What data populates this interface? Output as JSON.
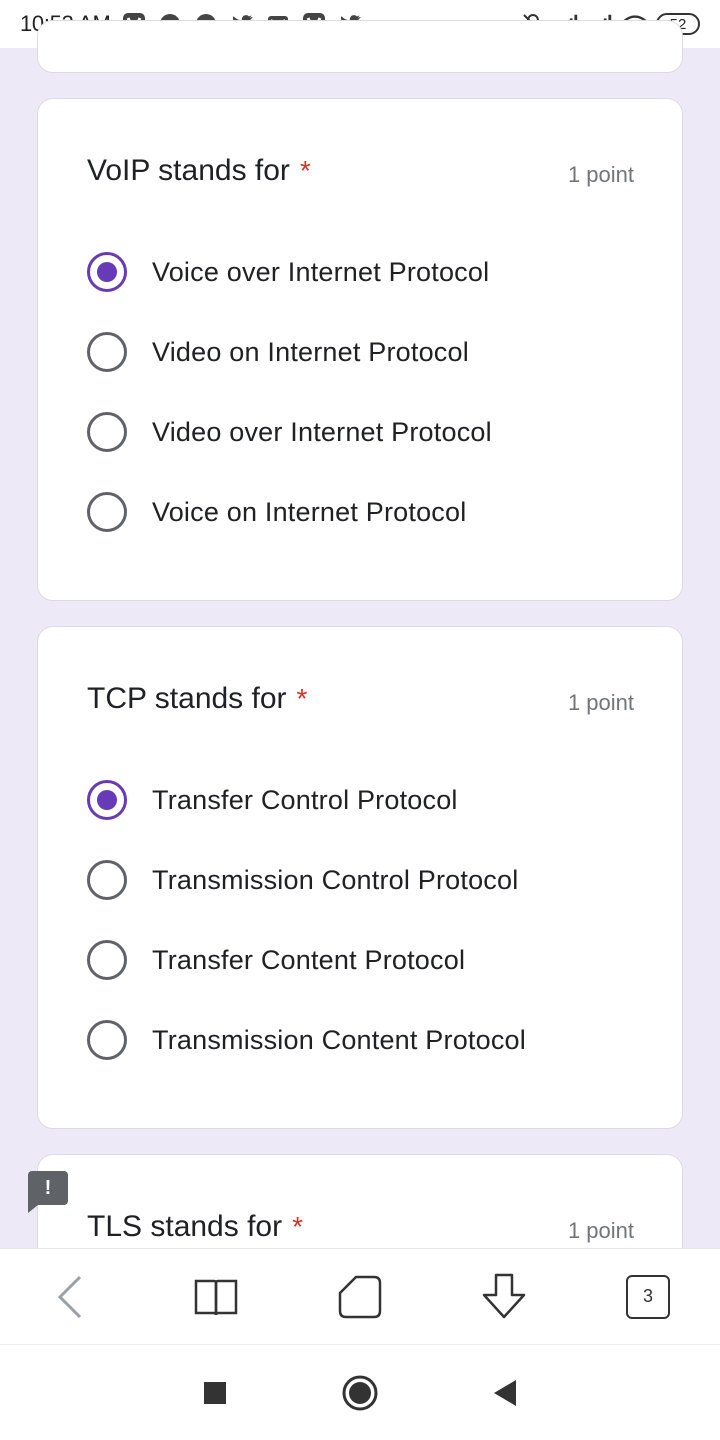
{
  "status_bar": {
    "time": "10:53 AM",
    "left_icons": [
      "vivaldi-icon",
      "messenger-icon",
      "messenger-icon",
      "twitter-icon",
      "gmail-icon",
      "vivaldi-icon",
      "twitter-icon"
    ],
    "right_icons": [
      "bell-muted-icon",
      "signal-icon",
      "signal-icon",
      "wifi-icon"
    ],
    "battery": "52"
  },
  "questions": [
    {
      "title": "VoIP stands for",
      "required_mark": "*",
      "points": "1 point",
      "options": [
        {
          "label": "Voice over Internet Protocol",
          "checked": true
        },
        {
          "label": "Video on Internet Protocol",
          "checked": false
        },
        {
          "label": "Video over Internet Protocol",
          "checked": false
        },
        {
          "label": "Voice on Internet Protocol",
          "checked": false
        }
      ]
    },
    {
      "title": "TCP stands for",
      "required_mark": "*",
      "points": "1 point",
      "options": [
        {
          "label": "Transfer Control Protocol",
          "checked": true
        },
        {
          "label": "Transmission Control Protocol",
          "checked": false
        },
        {
          "label": "Transfer Content Protocol",
          "checked": false
        },
        {
          "label": "Transmission Content Protocol",
          "checked": false
        }
      ]
    },
    {
      "title": "TLS stands for",
      "required_mark": "*",
      "points": "1 point"
    }
  ],
  "feedback": {
    "icon": "feedback-exclamation-icon",
    "label": "!"
  },
  "browser_toolbar": {
    "items": [
      "back-icon",
      "reader-icon",
      "home-icon",
      "download-icon",
      "tabs-icon"
    ],
    "tab_count": "3"
  },
  "nav_bar": {
    "items": [
      "recents-icon",
      "home-circle-icon",
      "back-triangle-icon"
    ]
  },
  "colors": {
    "accent": "#673ab7",
    "required": "#d93025",
    "background": "#ede9f7"
  }
}
